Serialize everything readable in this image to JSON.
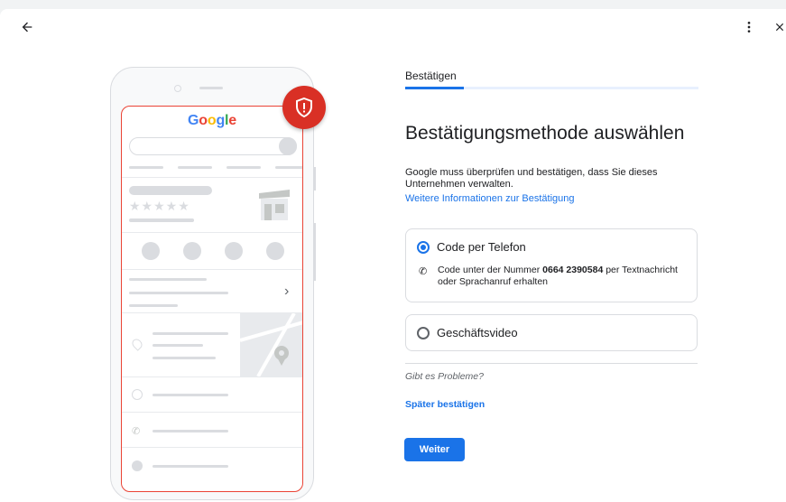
{
  "header": {
    "back_icon": "arrow-left-icon",
    "more_icon": "more-vert-icon",
    "close_icon": "close-icon"
  },
  "illustration": {
    "logo_letters": [
      "G",
      "o",
      "o",
      "g",
      "l",
      "e"
    ],
    "logo_colors": [
      "#4285f4",
      "#ea4335",
      "#fbbc05",
      "#4285f4",
      "#34a853",
      "#ea4335"
    ],
    "badge_icon": "shield-alert-icon",
    "badge_color": "#d93025",
    "stars": "★★★★★",
    "chevron": "›"
  },
  "stepper": {
    "label": "Bestätigen",
    "accent": "#1a73e8"
  },
  "main": {
    "heading": "Bestätigungsmethode auswählen",
    "description": "Google muss überprüfen und bestätigen, dass Sie dieses Unternehmen verwalten.",
    "info_link": "Weitere Informationen zur Bestätigung"
  },
  "options": [
    {
      "label": "Code per Telefon",
      "selected": true,
      "detail_prefix": "Code unter der Nummer ",
      "detail_number": "0664 2390584",
      "detail_suffix": " per Textnachricht oder Sprachanruf erhalten",
      "detail_icon": "phone-icon"
    },
    {
      "label": "Geschäftsvideo",
      "selected": false
    }
  ],
  "footer": {
    "problem_text": "Gibt es Probleme?",
    "later_link": "Später bestätigen",
    "next_button": "Weiter"
  }
}
